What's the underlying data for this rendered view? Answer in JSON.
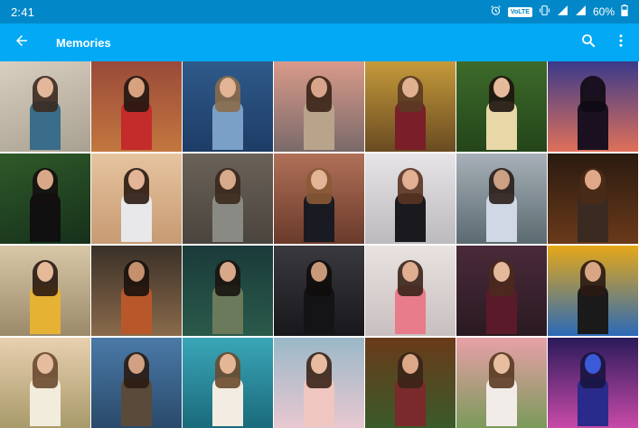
{
  "status_bar": {
    "time": "2:41",
    "volte_label": "VoLTE",
    "battery_percent": "60%",
    "icons": [
      "alarm-icon",
      "vibrate-icon",
      "signal-icon",
      "wifi-icon",
      "battery-icon"
    ]
  },
  "app_bar": {
    "title": "Memories",
    "back_icon": "arrow-back-icon",
    "search_icon": "search-icon",
    "more_icon": "more-vert-icon"
  },
  "colors": {
    "status_bar": "#0288c9",
    "app_bar": "#03a9f4"
  },
  "photos": [
    {
      "bg": "linear-gradient(160deg,#d9cfc2,#a8a090)",
      "skin": "#e3b79a",
      "hair": "#3b2a20",
      "cloth": "#3a6d8a"
    },
    {
      "bg": "linear-gradient(180deg,#9a4a3a,#c2773e)",
      "skin": "#d9a27e",
      "hair": "#241712",
      "cloth": "#c42b2b"
    },
    {
      "bg": "linear-gradient(180deg,#2f5a8a,#1d3c66)",
      "skin": "#e2b493",
      "hair": "#8a6b4a",
      "cloth": "#7aa0c8"
    },
    {
      "bg": "linear-gradient(180deg,#d99a8a,#7a6a6a)",
      "skin": "#d9a58a",
      "hair": "#3a2418",
      "cloth": "#b8a48a"
    },
    {
      "bg": "linear-gradient(180deg,#c49a3a,#6a4a22)",
      "skin": "#e0b090",
      "hair": "#5a3a22",
      "cloth": "#7a1e2a"
    },
    {
      "bg": "linear-gradient(180deg,#3d6a2a,#24451a)",
      "skin": "#e6bb9c",
      "hair": "#1e140e",
      "cloth": "#e8d8a8"
    },
    {
      "bg": "linear-gradient(180deg,#3a3a8a,#e0705a)",
      "skin": "#1a1020",
      "hair": "#0e0a12",
      "cloth": "#1a1020"
    },
    {
      "bg": "linear-gradient(160deg,#2f5a2a,#16301a)",
      "skin": "#d8a888",
      "hair": "#141010",
      "cloth": "#101010"
    },
    {
      "bg": "linear-gradient(180deg,#e6c4a0,#c79a72)",
      "skin": "#e3b496",
      "hair": "#2a1a12",
      "cloth": "#e8e8ea"
    },
    {
      "bg": "linear-gradient(180deg,#6a6258,#4a443e)",
      "skin": "#d8aa8c",
      "hair": "#3a281c",
      "cloth": "#8a8a84"
    },
    {
      "bg": "linear-gradient(180deg,#b07058,#6a3a2a)",
      "skin": "#e4b496",
      "hair": "#8a5a36",
      "cloth": "#1a1a22"
    },
    {
      "bg": "linear-gradient(180deg,#e6e4e6,#bcbabc)",
      "skin": "#e2b092",
      "hair": "#5a3422",
      "cloth": "#1a1a1e"
    },
    {
      "bg": "linear-gradient(180deg,#a8b0b8,#5a6a70)",
      "skin": "#cca084",
      "hair": "#2a1e18",
      "cloth": "#cfd8e4"
    },
    {
      "bg": "linear-gradient(180deg,#2a1a10,#6a3a1a)",
      "skin": "#e0a888",
      "hair": "#4a2a18",
      "cloth": "#3a2a22"
    },
    {
      "bg": "linear-gradient(180deg,#d8c8a8,#9a8a6a)",
      "skin": "#e6ba98",
      "hair": "#2a1a12",
      "cloth": "#e6b234"
    },
    {
      "bg": "linear-gradient(180deg,#3a3028,#8a6a4a)",
      "skin": "#c4906e",
      "hair": "#1a120c",
      "cloth": "#b8582a"
    },
    {
      "bg": "linear-gradient(180deg,#1a3a3a,#2a5a4a)",
      "skin": "#d8a888",
      "hair": "#1a1410",
      "cloth": "#6a7a5a"
    },
    {
      "bg": "linear-gradient(180deg,#3a3a3e,#18181c)",
      "skin": "#c8987a",
      "hair": "#100c0c",
      "cloth": "#141416"
    },
    {
      "bg": "linear-gradient(180deg,#e8e2e0,#c8c0c0)",
      "skin": "#e0ae90",
      "hair": "#3a2418",
      "cloth": "#e87c8a"
    },
    {
      "bg": "linear-gradient(180deg,#4a2a3a,#2a1a22)",
      "skin": "#e4b89a",
      "hair": "#4a2a1e",
      "cloth": "#5a1a2a"
    },
    {
      "bg": "linear-gradient(180deg,#e6a818,#2a6ab8)",
      "skin": "#d8a684",
      "hair": "#2a1a12",
      "cloth": "#1a1a1a"
    },
    {
      "bg": "linear-gradient(180deg,#e8d0b0,#a89a6a)",
      "skin": "#e6bc9e",
      "hair": "#6a4a30",
      "cloth": "#f2ecdc"
    },
    {
      "bg": "linear-gradient(180deg,#4a7aa8,#2a4a6a)",
      "skin": "#d2a082",
      "hair": "#2a1c14",
      "cloth": "#5a4a3a"
    },
    {
      "bg": "linear-gradient(180deg,#3aa6b8,#1a6a7a)",
      "skin": "#e4b696",
      "hair": "#6a4a2e",
      "cloth": "#f2ece2"
    },
    {
      "bg": "linear-gradient(180deg,#9ab8c8,#e8c8d0)",
      "skin": "#e8bca0",
      "hair": "#3a2418",
      "cloth": "#f0c6c0"
    },
    {
      "bg": "linear-gradient(180deg,#6a3a1a,#3a5a2a)",
      "skin": "#dca888",
      "hair": "#3a2418",
      "cloth": "#7a2a2a"
    },
    {
      "bg": "linear-gradient(180deg,#e8a0a8,#7a9a5a)",
      "skin": "#e8bea0",
      "hair": "#5a3a22",
      "cloth": "#f2ece8"
    },
    {
      "bg": "linear-gradient(180deg,#2a1a5a,#c84aa8)",
      "skin": "#3a5ad8",
      "hair": "#1a1440",
      "cloth": "#2a2a8a"
    }
  ]
}
